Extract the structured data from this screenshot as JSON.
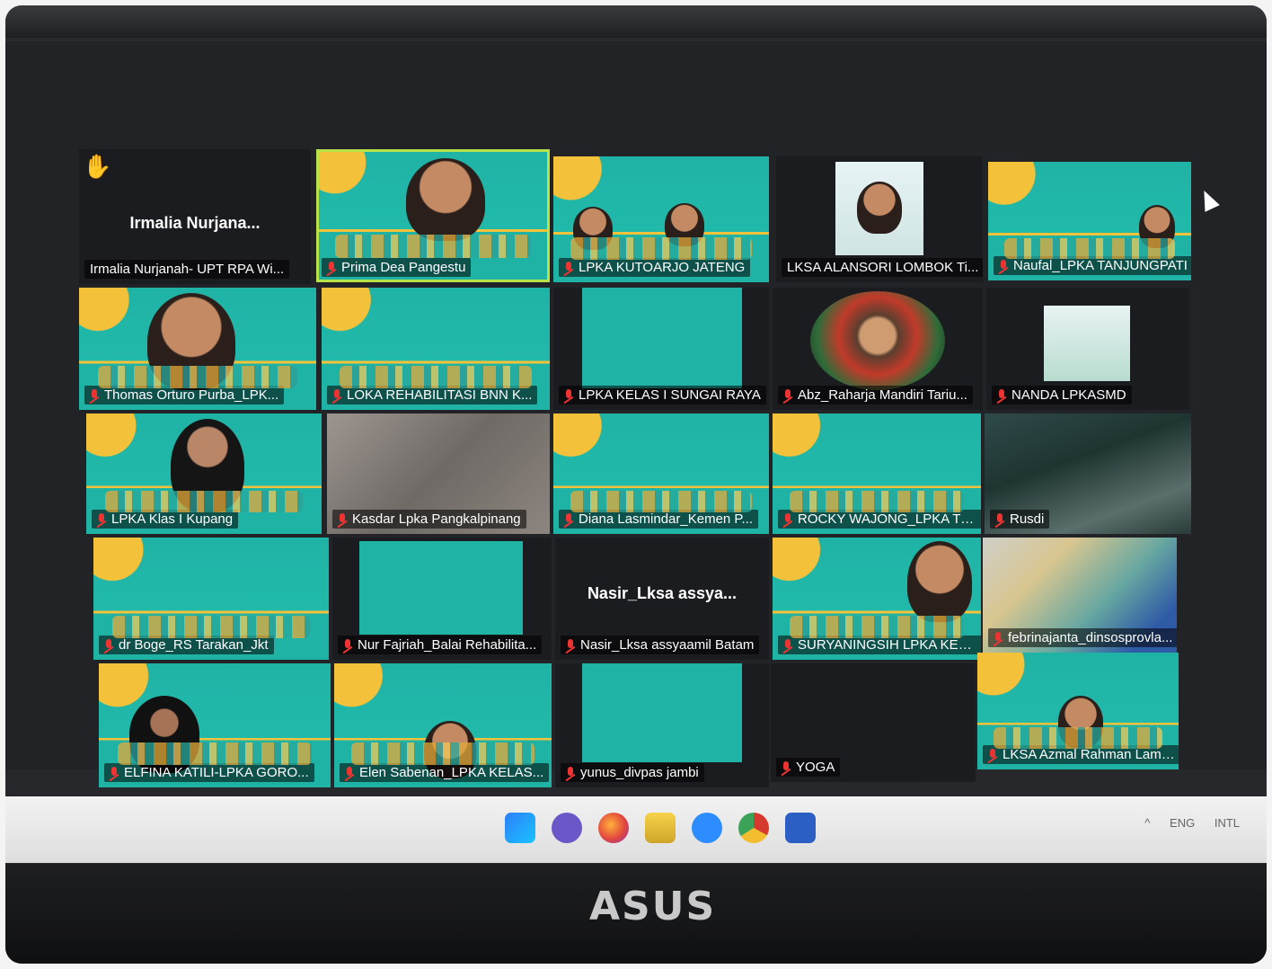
{
  "participants": [
    {
      "id": "p1",
      "name": "Irmalia Nurjanah- UPT RPA Wi...",
      "center_name": "Irmalia  Nurjana..."
    },
    {
      "id": "p2",
      "name": "Prima Dea Pangestu"
    },
    {
      "id": "p3",
      "name": "LPKA KUTOARJO JATENG"
    },
    {
      "id": "p4",
      "name": "LKSA ALANSORI LOMBOK Ti..."
    },
    {
      "id": "p5",
      "name": "Naufal_LPKA TANJUNGPATI"
    },
    {
      "id": "p6",
      "name": "Thomas Orturo Purba_LPK..."
    },
    {
      "id": "p7",
      "name": "LOKA REHABILITASI BNN K..."
    },
    {
      "id": "p8",
      "name": "LPKA KELAS I SUNGAI RAYA"
    },
    {
      "id": "p9",
      "name": "Abz_Raharja Mandiri Tariu..."
    },
    {
      "id": "p10",
      "name": "NANDA LPKASMD"
    },
    {
      "id": "p11",
      "name": "LPKA Klas I Kupang"
    },
    {
      "id": "p12",
      "name": "Kasdar Lpka Pangkalpinang"
    },
    {
      "id": "p13",
      "name": "Diana Lasmindar_Kemen P..."
    },
    {
      "id": "p14",
      "name": "ROCKY WAJONG_LPKA TO..."
    },
    {
      "id": "p15",
      "name": "Rusdi"
    },
    {
      "id": "p16",
      "name": "dr Boge_RS Tarakan_Jkt"
    },
    {
      "id": "p17",
      "name": "Nur Fajriah_Balai Rehabilita..."
    },
    {
      "id": "p18",
      "name": "Nasir_Lksa assyaamil Batam",
      "center_name": "Nasir_Lksa assya..."
    },
    {
      "id": "p19",
      "name": "SURYANINGSIH LPKA KELA..."
    },
    {
      "id": "p20",
      "name": "febrinajanta_dinsosprovla..."
    },
    {
      "id": "p21",
      "name": "ELFINA KATILI-LPKA GORO..."
    },
    {
      "id": "p22",
      "name": "Elen Sabenan_LPKA KELAS..."
    },
    {
      "id": "p23",
      "name": "yunus_divpas jambi"
    },
    {
      "id": "p24",
      "name": "YOGA"
    },
    {
      "id": "p25",
      "name": "LKSA Azmal Rahman Lamp..."
    }
  ],
  "taskbar": {
    "tray": [
      "ENG",
      "INTL"
    ]
  },
  "monitor": {
    "brand": "ASUS"
  },
  "colors": {
    "teal": "#1fb3a6",
    "yellow": "#f4c23a",
    "active": "#b8e24a"
  }
}
